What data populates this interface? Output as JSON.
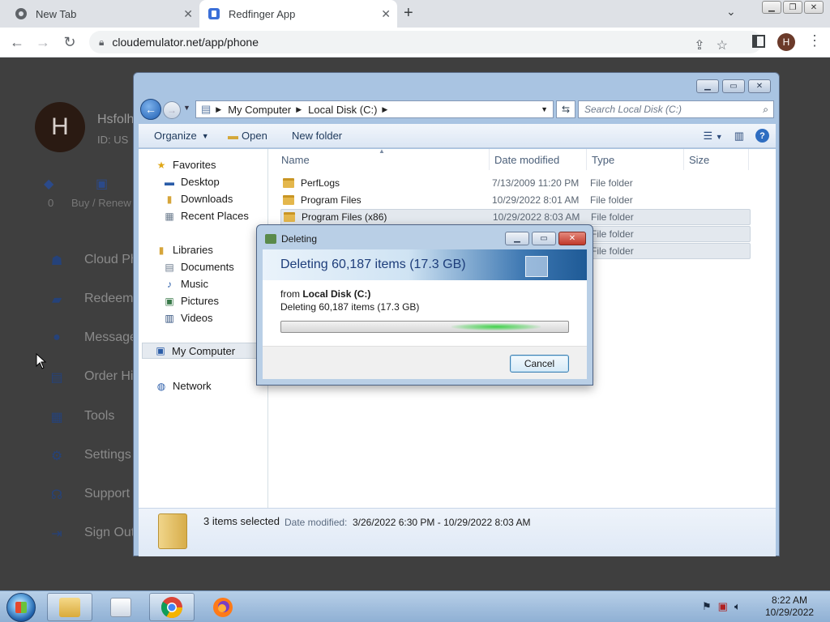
{
  "browser": {
    "tabs": [
      {
        "label": "New Tab"
      },
      {
        "label": "Redfinger App"
      }
    ],
    "url": "cloudemulator.net/app/phone",
    "profile_initial": "H"
  },
  "webpage": {
    "avatar_initial": "H",
    "user_name": "Hsfolh",
    "user_id": "ID: US",
    "stat_left": "0",
    "stat_right": "Buy / Renew",
    "menu": [
      {
        "label": "Cloud Ph",
        "icon": "phone-icon"
      },
      {
        "label": "Redeem",
        "icon": "ticket-icon"
      },
      {
        "label": "Message",
        "icon": "message-icon"
      },
      {
        "label": "Order Hi",
        "icon": "order-icon"
      },
      {
        "label": "Tools",
        "icon": "tools-icon"
      },
      {
        "label": "Settings",
        "icon": "gear-icon"
      },
      {
        "label": "Support",
        "icon": "headset-icon"
      },
      {
        "label": "Sign Out",
        "icon": "signout-icon"
      }
    ]
  },
  "explorer": {
    "breadcrumb": [
      "My Computer",
      "Local Disk (C:)"
    ],
    "search_placeholder": "Search Local Disk (C:)",
    "commands": {
      "organize": "Organize",
      "open": "Open",
      "new_folder": "New folder"
    },
    "nav": {
      "favorites": "Favorites",
      "desktop": "Desktop",
      "downloads": "Downloads",
      "recent_places": "Recent Places",
      "libraries": "Libraries",
      "documents": "Documents",
      "music": "Music",
      "pictures": "Pictures",
      "videos": "Videos",
      "my_computer": "My Computer",
      "network": "Network"
    },
    "columns": {
      "name": "Name",
      "date": "Date modified",
      "type": "Type",
      "size": "Size"
    },
    "files": [
      {
        "name": "PerfLogs",
        "date": "7/13/2009 11:20 PM",
        "type": "File folder",
        "selected": false
      },
      {
        "name": "Program Files",
        "date": "10/29/2022 8:01 AM",
        "type": "File folder",
        "selected": false
      },
      {
        "name": "Program Files (x86)",
        "date": "10/29/2022 8:03 AM",
        "type": "File folder",
        "selected": true
      },
      {
        "name": "",
        "date": "",
        "type": "File folder",
        "selected": true
      },
      {
        "name": "",
        "date": "",
        "type": "File folder",
        "selected": true
      }
    ],
    "details": {
      "count": "3 items selected",
      "modified_label": "Date modified:",
      "modified_value": "3/26/2022 6:30 PM - 10/29/2022 8:03 AM"
    }
  },
  "dialog": {
    "title": "Deleting",
    "banner": "Deleting 60,187 items (17.3 GB)",
    "from_label": "from",
    "from_location": "Local Disk (C:)",
    "detail": "Deleting 60,187 items (17.3 GB)",
    "cancel": "Cancel"
  },
  "taskbar": {
    "time": "8:22 AM",
    "date": "10/29/2022"
  },
  "colors": {
    "accent_blue": "#1d5ea8",
    "page_bg": "#3f3f3f",
    "folder_yellow": "#e4b74c"
  }
}
